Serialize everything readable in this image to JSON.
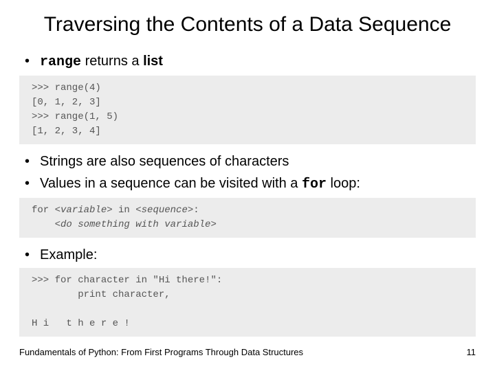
{
  "title": "Traversing the Contents of a Data Sequence",
  "bullets": {
    "b1_pre": "range",
    "b1_post": " returns a ",
    "b1_bold": "list",
    "b2": "Strings are also sequences of characters",
    "b3_pre": "Values in a sequence can be visited with a ",
    "b3_code": "for",
    "b3_post": " loop:",
    "b4": "Example:"
  },
  "code1": {
    "l1": ">>> range(4)",
    "l2": "[0, 1, 2, 3]",
    "l3": ">>> range(1, 5)",
    "l4": "[1, 2, 3, 4]"
  },
  "code2": {
    "l1a": "for ",
    "l1b": "<variable>",
    "l1c": " in ",
    "l1d": "<sequence>",
    "l1e": ":",
    "l2a": "    ",
    "l2b": "<do something with variable>"
  },
  "code3": {
    "l1": ">>> for character in \"Hi there!\":",
    "l2": "        print character,",
    "l3": "",
    "l4": "H i   t h e r e !"
  },
  "footer": {
    "left": "Fundamentals of Python: From First Programs Through Data Structures",
    "right": "11"
  }
}
